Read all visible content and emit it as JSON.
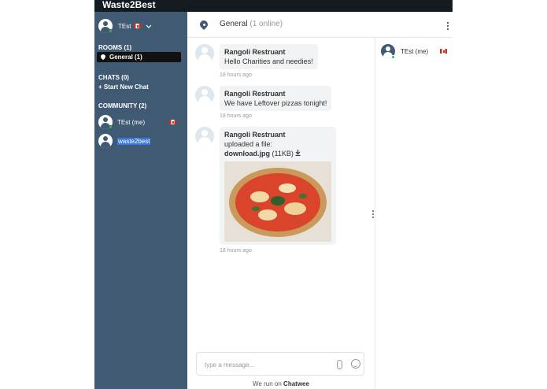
{
  "app": {
    "title": "Waste2Best"
  },
  "sidebar": {
    "current_user": {
      "name": "TEst",
      "country_flag": "Canada"
    },
    "rooms": {
      "title": "ROOMS (1)",
      "items": [
        {
          "label": "General (1)"
        }
      ]
    },
    "chats": {
      "title": "CHATS (0)",
      "start_label": "+ Start New Chat"
    },
    "community": {
      "title": "COMMUNITY (2)",
      "members": [
        {
          "name": "TEst (me)",
          "country_flag": "Canada",
          "online": true
        },
        {
          "name": "waste2best",
          "online": false,
          "selected": true
        }
      ]
    }
  },
  "chat": {
    "room_name": "General",
    "online_count": "(1 online)",
    "messages": [
      {
        "sender": "Rangoli Restruant",
        "text": "Hello Charities and needies!",
        "time": "18 hours ago"
      },
      {
        "sender": "Rangoli Restruant",
        "text": "We have Leftover pizzas tonight!",
        "time": "18 hours ago"
      },
      {
        "sender": "Rangoli Restruant",
        "text": "uploaded a file:",
        "file_name": "download.jpg",
        "file_size": "(11KB)",
        "time": "18 hours ago"
      }
    ],
    "composer_placeholder": "type a message...",
    "footer_prefix": "We run on",
    "footer_brand": "Chatwee"
  },
  "members_panel": {
    "items": [
      {
        "name": "TEst (me)",
        "country_flag": "Canada",
        "online": true
      }
    ]
  },
  "colors": {
    "sidebar": "#3f5a72",
    "topbar": "#131a20",
    "online": "#2fbf4a",
    "selection": "#3b77d8"
  }
}
